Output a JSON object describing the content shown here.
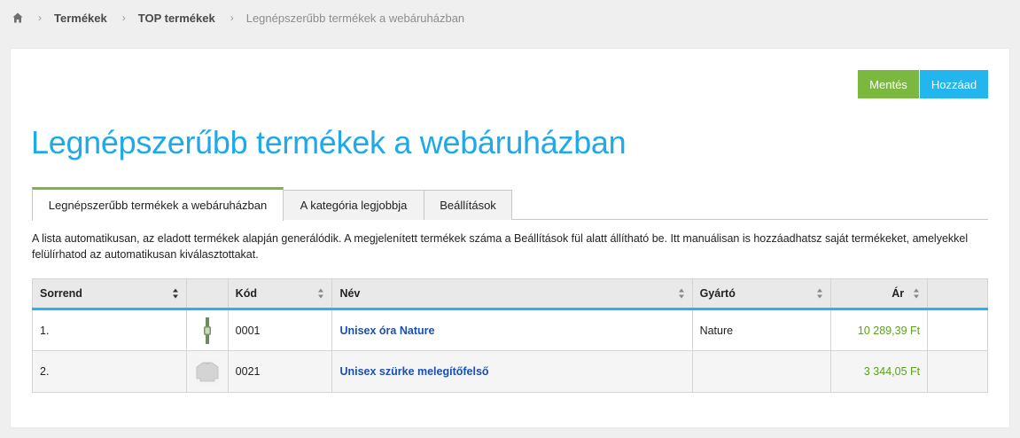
{
  "breadcrumb": {
    "home_icon": "home-icon",
    "items": [
      "Termékek",
      "TOP termékek"
    ],
    "current": "Legnépszerűbb termékek a webáruházban",
    "separator": "›"
  },
  "toolbar": {
    "save_label": "Mentés",
    "add_label": "Hozzáad",
    "save_color": "#7ab83f",
    "add_color": "#23b5ee"
  },
  "page": {
    "title": "Legnépszerűbb termékek a webáruházban"
  },
  "tabs": [
    {
      "label": "Legnépszerűbb termékek a webáruházban",
      "active": true
    },
    {
      "label": "A kategória legjobbja",
      "active": false
    },
    {
      "label": "Beállítások",
      "active": false
    }
  ],
  "info_text": "A lista automatikusan, az eladott termékek alapján generálódik. A megjelenített termékek száma a Beállítások fül alatt állítható be. Itt manuálisan is hozzáadhatsz saját termékeket, amelyekkel felülírhatod az automatikusan kiválasztottakat.",
  "table": {
    "headers": {
      "order": "Sorrend",
      "image": "",
      "code": "Kód",
      "name": "Név",
      "manufacturer": "Gyártó",
      "price": "Ár",
      "actions": ""
    },
    "rows": [
      {
        "order": "1.",
        "image_icon": "watch-icon",
        "code": "0001",
        "name": "Unisex óra Nature",
        "manufacturer": "Nature",
        "price": "10 289,39 Ft"
      },
      {
        "order": "2.",
        "image_icon": "sweater-icon",
        "code": "0021",
        "name": "Unisex szürke melegítőfelső",
        "manufacturer": "",
        "price": "3 344,05 Ft"
      }
    ]
  }
}
